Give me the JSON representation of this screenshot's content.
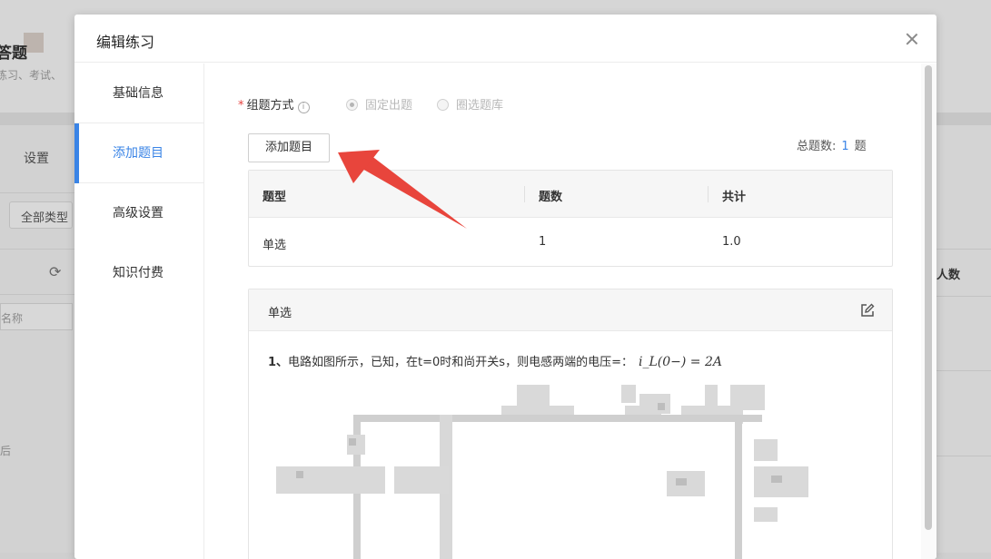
{
  "background": {
    "title": "答题",
    "subtitle": "练习、考试、",
    "tab": "设置",
    "filter": "全部类型",
    "search_fragment": "名称",
    "row_fragment": "后",
    "column_fragment": "人数"
  },
  "modal": {
    "title": "编辑练习",
    "close_icon": "close-icon",
    "sidebar": {
      "items": [
        {
          "label": "基础信息",
          "active": false
        },
        {
          "label": "添加题目",
          "active": true
        },
        {
          "label": "高级设置",
          "active": false
        },
        {
          "label": "知识付费",
          "active": false
        }
      ]
    },
    "form": {
      "mode_label": "组题方式",
      "mode_info_icon": "info-icon",
      "options": [
        {
          "label": "固定出题",
          "checked": true,
          "disabled": true
        },
        {
          "label": "圈选题库",
          "checked": false,
          "disabled": true
        }
      ],
      "add_button": "添加题目",
      "total_label": "总题数:",
      "total_count": "1",
      "total_unit": "题"
    },
    "summary_table": {
      "headers": [
        "题型",
        "题数",
        "共计"
      ],
      "rows": [
        [
          "单选",
          "1",
          "1.0"
        ]
      ]
    },
    "question_card": {
      "title": "单选",
      "edit_icon": "edit-icon",
      "number": "1、",
      "text": "电路如图所示，已知，在t=0时和尚开关s，则电感两端的电压=：",
      "formula": "i_L(0−) = 2A"
    }
  },
  "colors": {
    "accent": "#3a84e6",
    "required": "#e64340",
    "arrow": "#e8453c"
  }
}
